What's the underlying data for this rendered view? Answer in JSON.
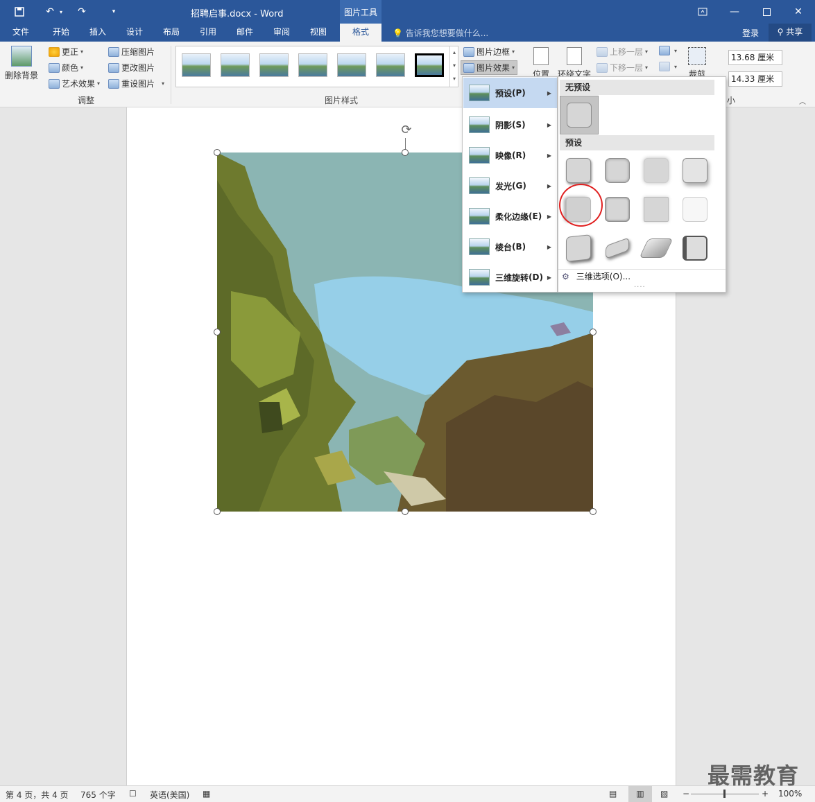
{
  "app": {
    "doc_title": "招聘启事.docx - Word",
    "context_tab_group": "图片工具"
  },
  "tabs": [
    "文件",
    "开始",
    "插入",
    "设计",
    "布局",
    "引用",
    "邮件",
    "审阅",
    "视图",
    "格式"
  ],
  "active_tab": "格式",
  "tell_me": "告诉我您想要做什么...",
  "account": {
    "login": "登录",
    "share": "共享"
  },
  "ribbon": {
    "remove_bg": "删除背景",
    "adjust": {
      "corrections": "更正",
      "color": "颜色",
      "artistic": "艺术效果",
      "compress": "压缩图片",
      "change": "更改图片",
      "reset": "重设图片",
      "label": "调整"
    },
    "styles_label": "图片样式",
    "border": "图片边框",
    "effects": "图片效果",
    "position": "位置",
    "wrap": "环绕文字",
    "forward": "上移一层",
    "backward": "下移一层",
    "crop": "裁剪",
    "height": "13.68 厘米",
    "width": "14.33 厘米",
    "size_label": "小"
  },
  "effects_menu": [
    {
      "label": "预设",
      "key": "(P)"
    },
    {
      "label": "阴影",
      "key": "(S)"
    },
    {
      "label": "映像",
      "key": "(R)"
    },
    {
      "label": "发光",
      "key": "(G)"
    },
    {
      "label": "柔化边缘",
      "key": "(E)"
    },
    {
      "label": "棱台",
      "key": "(B)"
    },
    {
      "label": "三维旋转",
      "key": "(D)"
    }
  ],
  "preset_panel": {
    "none_header": "无预设",
    "preset_header": "预设",
    "options_3d": "三维选项(O)..."
  },
  "status": {
    "page": "第 4 页，共 4 页",
    "words": "765 个字",
    "language": "英语(美国)",
    "zoom": "100%"
  },
  "watermark": "最需教育"
}
